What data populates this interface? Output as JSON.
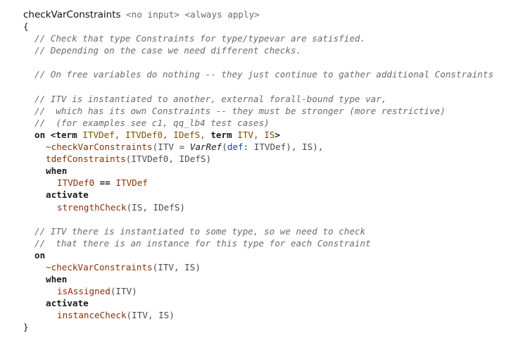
{
  "rule": {
    "name": "checkVarConstraints",
    "annotations": [
      "<no input>",
      "<always apply>"
    ],
    "open_brace": "{",
    "close_brace": "}"
  },
  "comments": {
    "c1": "// Check that type Constraints for type/typevar are satisfied.",
    "c2": "// Depending on the case we need different checks.",
    "c3": "// On free variables do nothing -- they just continue to gather additional Constraints",
    "c4": "// ITV is instantiated to another, external forall-bound type var,",
    "c5": "//  which has its own Constraints -- they must be stronger (more restrictive)",
    "c6": "//  (for examples see c1, qq_lb4 test cases)",
    "c7": "// ITV there is instantiated to some type, so we need to check",
    "c8": "//  that there is an instance for this type for each Constraint"
  },
  "keywords": {
    "on": "on",
    "term": "term",
    "when": "when",
    "activate": "activate",
    "eqeq": "=="
  },
  "clause1": {
    "pattern_open": "<",
    "pattern_close": ">",
    "p1": "ITVDef,",
    "p2": "ITVDef0,",
    "p3": "IDefS,",
    "p4": "ITV,",
    "p5": "IS",
    "head_fn": "~checkVarConstraints",
    "head_args_a": "(ITV = ",
    "head_varref": "VarRef",
    "head_paren": "(",
    "head_field": "def:",
    "head_args_b": " ITVDef), IS),",
    "head2_fn": "tdefConstraints",
    "head2_args": "(ITVDef0, IDefS)",
    "guard_left": "ITVDef0",
    "guard_right": "ITVDef",
    "body_fn": "strengthCheck",
    "body_args": "(IS, IDefS)"
  },
  "clause2": {
    "head_fn": "~checkVarConstraints",
    "head_args": "(ITV, IS)",
    "guard_fn": "isAssigned",
    "guard_args": "(ITV)",
    "body_fn": "instanceCheck",
    "body_args": "(ITV, IS)"
  }
}
